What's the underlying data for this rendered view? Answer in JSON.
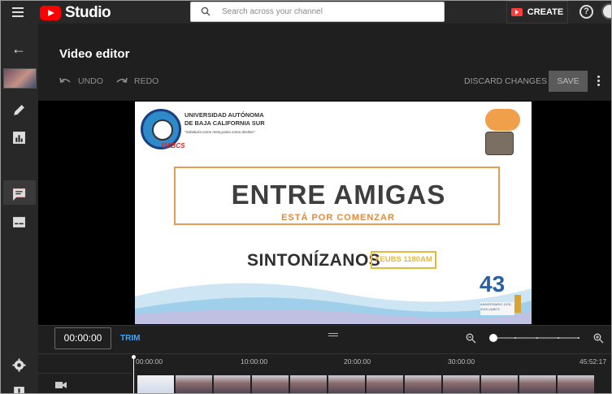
{
  "app": {
    "logo_text": "Studio"
  },
  "search": {
    "placeholder": "Search across your channel"
  },
  "header_actions": {
    "create_label": "CREATE",
    "help_glyph": "?"
  },
  "editor": {
    "title": "Video editor",
    "undo_label": "UNDO",
    "redo_label": "REDO",
    "discard_label": "DISCARD CHANGES",
    "save_label": "SAVE"
  },
  "sidebar": {
    "items": [
      {
        "name": "back-arrow-icon"
      },
      {
        "name": "video-thumbnail"
      },
      {
        "name": "pencil-icon"
      },
      {
        "name": "analytics-icon"
      },
      {
        "name": "video-editor-icon",
        "active": true
      },
      {
        "name": "comments-icon"
      },
      {
        "name": "subtitles-icon"
      },
      {
        "name": "settings-icon"
      },
      {
        "name": "feedback-icon"
      }
    ]
  },
  "video_preview": {
    "university_line1": "UNIVERSIDAD AUTÓNOMA",
    "university_line2": "DE BAJA CALIFORNIA SUR",
    "motto": "\"Sabiduría como meta,patria como destino\"",
    "uabcs_tag": "UABCS",
    "headline": "ENTRE AMIGAS",
    "subheadline": "ESTÁ POR COMENZAR",
    "tune_in": "SINTONÍZANOS",
    "frequency": "XEUBS 1180AM",
    "anniversary_number": "43",
    "anniversary_text": "ANIVERSARIO 1976-2019 UABCS"
  },
  "timeline": {
    "current_time": "00:00:00",
    "trim_label": "TRIM",
    "ruler": [
      "00:00:00",
      "10:00:00",
      "20:00:00",
      "30:00:00",
      "45:52:17"
    ],
    "zoom_level": 0
  },
  "colors": {
    "accent_red": "#ff0000",
    "link_blue": "#3ea6ff",
    "bg_dark": "#1f1f1f",
    "bar_dark": "#282828"
  }
}
